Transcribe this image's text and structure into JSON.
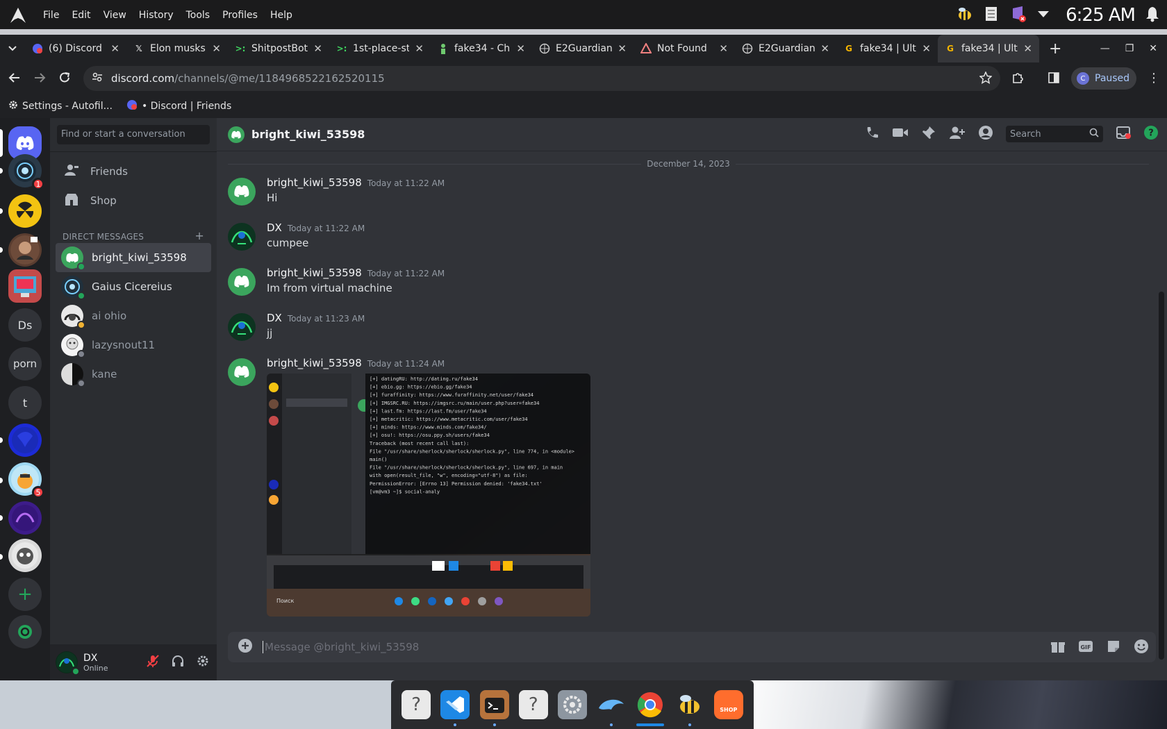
{
  "system": {
    "menu": [
      "File",
      "Edit",
      "View",
      "History",
      "Tools",
      "Profiles",
      "Help"
    ],
    "clock": "6:25 AM"
  },
  "browser": {
    "tabs": [
      {
        "label": "(6) Discord |",
        "icon": "discord-icon"
      },
      {
        "label": "Elon musks",
        "icon": "x-icon"
      },
      {
        "label": "ShitpostBot",
        "icon": "terminal-icon"
      },
      {
        "label": "1st-place-st",
        "icon": "terminal-icon"
      },
      {
        "label": "fake34 - Ch",
        "icon": "figure-icon"
      },
      {
        "label": "E2Guardian",
        "icon": "globe-icon"
      },
      {
        "label": "Not Found",
        "icon": "warning-icon"
      },
      {
        "label": "E2Guardian",
        "icon": "globe-icon"
      },
      {
        "label": "fake34 | Ult",
        "icon": "g-icon"
      },
      {
        "label": "fake34 | Ult",
        "icon": "g-icon"
      }
    ],
    "url_host": "discord.com",
    "url_path": "/channels/@me/1184968522162520115",
    "profile_initial": "C",
    "profile_status": "Paused",
    "bookmarks": [
      "Settings - Autofil...",
      "• Discord | Friends"
    ]
  },
  "discord": {
    "guild_labels": {
      "ds": "Ds",
      "porn": "porn",
      "t": "t"
    },
    "guild_badges": {
      "first": "1",
      "fifth": "5"
    },
    "dm_search_placeholder": "Find or start a conversation",
    "nav": {
      "friends": "Friends",
      "shop": "Shop"
    },
    "dm_header": "DIRECT MESSAGES",
    "dm_add": "+",
    "dms": [
      {
        "name": "bright_kiwi_53598"
      },
      {
        "name": "Gaius Cicereius"
      },
      {
        "name": "ai ohio"
      },
      {
        "name": "lazysnout11"
      },
      {
        "name": "kane"
      }
    ],
    "user": {
      "name": "DX",
      "status": "Online"
    },
    "channel_name": "bright_kiwi_53598",
    "header_search": "Search",
    "date_divider": "December 14, 2023",
    "messages": [
      {
        "author": "bright_kiwi_53598",
        "time": "Today at 11:22 AM",
        "text": "Hi"
      },
      {
        "author": "DX",
        "time": "Today at 11:22 AM",
        "text": "cumpee"
      },
      {
        "author": "bright_kiwi_53598",
        "time": "Today at 11:22 AM",
        "text": "Im from virtual machine"
      },
      {
        "author": "DX",
        "time": "Today at 11:23 AM",
        "text": "jj"
      },
      {
        "author": "bright_kiwi_53598",
        "time": "Today at 11:24 AM",
        "text": ""
      }
    ],
    "composer_placeholder": "Message @bright_kiwi_53598"
  },
  "photo_terminal_lines": [
    "[+] datingRU: http://dating.ru/fake34",
    "[+] ebio.gg: https://ebio.gg/fake34",
    "[+] furaffinity: https://www.furaffinity.net/user/fake34",
    "[+] IMGSRC.RU: https://imgsrc.ru/main/user.php?user=fake34",
    "[+] last.fm: https://last.fm/user/fake34",
    "[+] metacritic: https://www.metacritic.com/user/fake34",
    "[+] minds: https://www.minds.com/fake34/",
    "[+] osu!: https://osu.ppy.sh/users/fake34",
    "Traceback (most recent call last):",
    "  File \"/usr/share/sherlock/sherlock/sherlock.py\", line 774, in <module>",
    "    main()",
    "  File \"/usr/share/sherlock/sherlock/sherlock.py\", line 697, in main",
    "    with open(result_file, \"w\", encoding=\"utf-8\") as file:",
    "PermissionError: [Errno 13] Permission denied: 'fake34.txt'",
    "[vm@vm3 ~]$ social-analy"
  ],
  "dock": {
    "shop_label": "SHOP"
  }
}
